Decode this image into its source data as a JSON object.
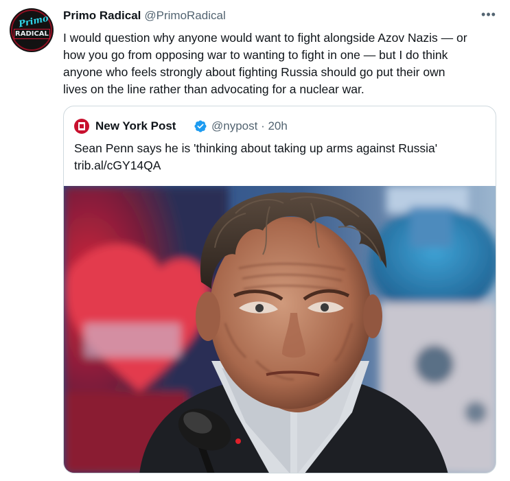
{
  "tweet": {
    "author_name": "Primo Radical",
    "author_handle": "@PrimoRadical",
    "avatar_script": "Primo",
    "avatar_logo": "RADICAL",
    "more_label": "•••",
    "text_lines": [
      "I would question why anyone would want to fight alongside Azov Nazis — or",
      "how you go from opposing war to wanting to fight in one — but I do think",
      "anyone who feels strongly about fighting Russia should go put their own",
      "lives on the line rather than advocating for a nuclear war."
    ]
  },
  "quote": {
    "author_name": "New York Post",
    "verified": true,
    "meta": "@nypost · 20h",
    "text_lines": [
      "Sean Penn says he is 'thinking about taking up arms against Russia'",
      "trib.al/cGY14QA"
    ],
    "image_alt": "Close-up photo of Sean Penn at a press conference with a microphone in front of him"
  },
  "colors": {
    "text": "#0f1419",
    "secondary": "#536471",
    "border": "#cfd9de",
    "verified": "#1d9bf0",
    "nypost_red": "#c8102e"
  }
}
